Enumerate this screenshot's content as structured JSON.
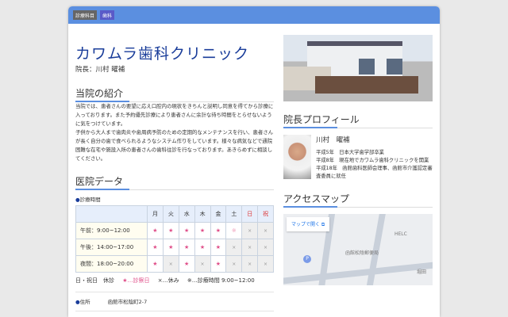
{
  "tags": [
    "診療科目",
    "歯科"
  ],
  "title": "カワムラ歯科クリニック",
  "director": "院長：川村 曜補",
  "intro": {
    "heading": "当院の紹介",
    "text": "当院では、患者さんの要望に応え口腔内の現状をきちんと説明し同意を得てから診療に入っております。また予約優先診療により患者さんに余計な待ち時間をとらせないように気をつけています。\n子供から大人まで歯肉炎や歯周病予防のための定期的なメンテナンスを行い、患者さんが長く自分の歯で食べられるようなシステム作りをしています。様々な病気などで通院困難な在宅や施設入所の患者さんの歯科往診を行なっております。あきらめずに相談してください。"
  },
  "data": {
    "heading": "医院データ",
    "hours_label": "診療時間",
    "days": [
      "月",
      "火",
      "水",
      "木",
      "金",
      "土",
      "日",
      "祝"
    ],
    "rows": [
      {
        "label": "午前：9:00~12:00",
        "cells": [
          "★",
          "★",
          "★",
          "★",
          "★",
          "※",
          "×",
          "×"
        ]
      },
      {
        "label": "午後：14:00~17:00",
        "cells": [
          "★",
          "★",
          "★",
          "★",
          "★",
          "×",
          "×",
          "×"
        ]
      },
      {
        "label": "夜間：18:00~20:00",
        "cells": [
          "★",
          "×",
          "★",
          "×",
          "★",
          "×",
          "×",
          "×"
        ]
      }
    ],
    "legend": [
      "日・祝日　休診",
      "★…診察日",
      "×…休み",
      "※…診療時間 9:00~12:00"
    ],
    "address_label": "住所",
    "address": "函館市松陰町2-7"
  },
  "profile": {
    "heading": "院長プロフィール",
    "name": "川村　曜補",
    "history": [
      "平成5年　日本大学歯学部卒業",
      "平成8年　現在地でカワムラ歯科クリニックを開業",
      "平成18年　函館歯科医師会理事、函館市介護認定審査委員に就任"
    ]
  },
  "access": {
    "heading": "アクセスマップ",
    "open_map": "マップで開く ⧉",
    "pois": [
      "HELC",
      "函館松陰郵便局",
      "P",
      "堀田"
    ]
  }
}
